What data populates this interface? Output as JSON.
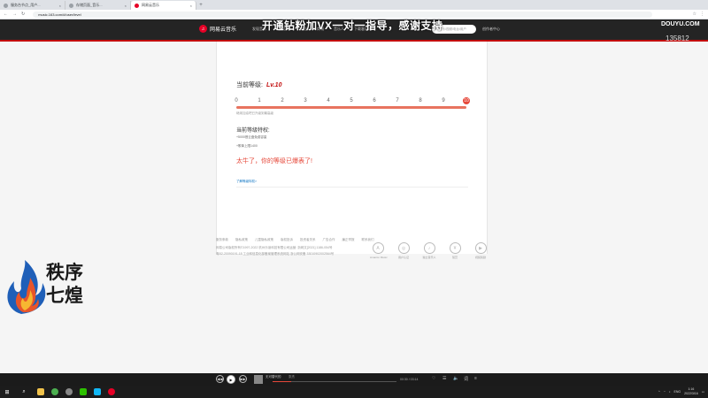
{
  "browser": {
    "tabs": [
      {
        "title": "服务台节点_用户...",
        "active": false
      },
      {
        "title": "存储页面_音乐...",
        "active": false
      },
      {
        "title": "网易云音乐",
        "active": true
      }
    ],
    "url": "music.163.com/#/user/level"
  },
  "site": {
    "brand": "网易云音乐",
    "nav": [
      "发现音乐",
      "我的音乐",
      "关注",
      "商城",
      "音乐人",
      "下载客户端"
    ],
    "search_placeholder": "音乐/视频/电台/用户",
    "creator_center": "创作者中心"
  },
  "level": {
    "label": "当前等级:",
    "value": "Lv.10",
    "ticks": [
      "0",
      "1",
      "2",
      "3",
      "4",
      "5",
      "6",
      "7",
      "8",
      "9",
      "10"
    ],
    "current_index": 10,
    "progress": 1.0,
    "bar_note": "继续加油吧已升级到最高级",
    "privileges_title": "当前等级特权:",
    "privileges": [
      "+5000首云盘免费容量",
      "+歌单上限1400"
    ],
    "maxed_message": "太牛了，你的等级已爆表了!",
    "more_link": "了解等级特权>"
  },
  "footer": {
    "links": [
      "服务条款",
      "隐私政策",
      "儿童隐私政策",
      "版权投诉",
      "投资者关系",
      "广告合作",
      "廉正举报",
      "联系我们"
    ],
    "lines": [
      "网易公司版权所有©1997-2022   杭州乐读科技有限公司运营: 浙网文[2021] 1186-054号",
      "粤B2-20090191-18   工业和信息化部备案管理系统网站   浙公网安备 33010902002564号"
    ],
    "badges": [
      {
        "label": "Amazon Music",
        "glyph": "A"
      },
      {
        "label": "用户认证",
        "glyph": "◎"
      },
      {
        "label": "独立音乐人",
        "glyph": "♪"
      },
      {
        "label": "赞赏",
        "glyph": "¥"
      },
      {
        "label": "视频奖励",
        "glyph": "▶"
      }
    ]
  },
  "overlay": {
    "banner": "开通钻粉加VX一对一指导，感谢支持",
    "platform": "DOUYU.COM",
    "room_id": "135812",
    "streamer_name": "秩序七煌"
  },
  "media": {
    "song": "无可替代的",
    "artist": "张杰",
    "time": "00:30 / 03:14",
    "progress": 0.15
  },
  "taskbar": {
    "clock_time": "1:16",
    "clock_date": "2022/3/16",
    "lang": "ENG",
    "apps": [
      {
        "name": "file-explorer",
        "color": "#f0c24b"
      },
      {
        "name": "chrome",
        "color": "#4caf50"
      },
      {
        "name": "obs",
        "color": "#888888"
      },
      {
        "name": "wechat",
        "color": "#2dc100"
      },
      {
        "name": "qq",
        "color": "#12b7f5"
      },
      {
        "name": "netease-music",
        "color": "#e60026"
      }
    ]
  },
  "colors": {
    "accent": "#c20c0c",
    "progress": "#e8735f",
    "highlight": "#e6483a"
  }
}
